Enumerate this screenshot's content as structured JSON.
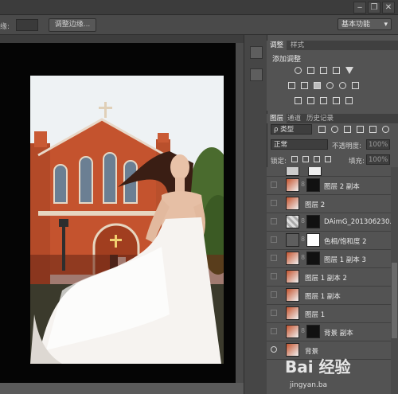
{
  "window_controls": [
    "‒",
    "❐",
    "✕"
  ],
  "options_bar": {
    "left_label": "缘:",
    "refine_button": "调整边缘...",
    "workspace": "基本功能"
  },
  "adjustments_panel": {
    "tabs": [
      "调整",
      "样式"
    ],
    "title": "添加调整"
  },
  "layers_panel": {
    "tabs": [
      "图层",
      "通道",
      "历史记录"
    ],
    "filter": "ρ 类型",
    "blend_mode": "正常",
    "opacity_label": "不透明度:",
    "opacity_value": "100%",
    "lock_label": "锁定:",
    "fill_label": "填充:",
    "fill_value": "100%",
    "layers": [
      {
        "name": "图层 2 副本",
        "has_mask": true
      },
      {
        "name": "图层 2",
        "has_mask": false
      },
      {
        "name": "DAimG_201306230...",
        "has_mask": false
      },
      {
        "name": "色相/饱和度 2",
        "has_mask": true
      },
      {
        "name": "图层 1 副本 3",
        "has_mask": true
      },
      {
        "name": "图层 1 副本 2",
        "has_mask": false
      },
      {
        "name": "图层 1 副本",
        "has_mask": false
      },
      {
        "name": "图层 1",
        "has_mask": false
      },
      {
        "name": "背景 副本",
        "has_mask": true
      },
      {
        "name": "背景",
        "has_mask": false
      }
    ]
  },
  "watermark": {
    "logo": "Bai 经验",
    "url": "jingyan.ba"
  },
  "colors": {
    "panel": "#535353",
    "dark": "#3c3c3c",
    "canvas": "#050505",
    "brick": "#c4532e"
  }
}
